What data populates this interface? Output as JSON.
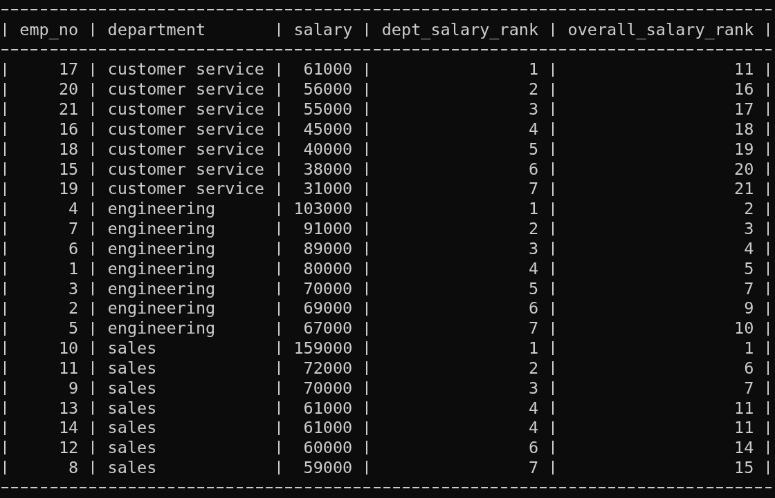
{
  "table": {
    "columns": [
      "emp_no",
      "department",
      "salary",
      "dept_salary_rank",
      "overall_salary_rank"
    ],
    "rows": [
      [
        "17",
        "customer service",
        "61000",
        "1",
        "11"
      ],
      [
        "20",
        "customer service",
        "56000",
        "2",
        "16"
      ],
      [
        "21",
        "customer service",
        "55000",
        "3",
        "17"
      ],
      [
        "16",
        "customer service",
        "45000",
        "4",
        "18"
      ],
      [
        "18",
        "customer service",
        "40000",
        "5",
        "19"
      ],
      [
        "15",
        "customer service",
        "38000",
        "6",
        "20"
      ],
      [
        "19",
        "customer service",
        "31000",
        "7",
        "21"
      ],
      [
        "4",
        "engineering",
        "103000",
        "1",
        "2"
      ],
      [
        "7",
        "engineering",
        "91000",
        "2",
        "3"
      ],
      [
        "6",
        "engineering",
        "89000",
        "3",
        "4"
      ],
      [
        "1",
        "engineering",
        "80000",
        "4",
        "5"
      ],
      [
        "3",
        "engineering",
        "70000",
        "5",
        "7"
      ],
      [
        "2",
        "engineering",
        "69000",
        "6",
        "9"
      ],
      [
        "5",
        "engineering",
        "67000",
        "7",
        "10"
      ],
      [
        "10",
        "sales",
        "159000",
        "1",
        "1"
      ],
      [
        "11",
        "sales",
        "72000",
        "2",
        "6"
      ],
      [
        "9",
        "sales",
        "70000",
        "3",
        "7"
      ],
      [
        "13",
        "sales",
        "61000",
        "4",
        "11"
      ],
      [
        "14",
        "sales",
        "61000",
        "4",
        "11"
      ],
      [
        "12",
        "sales",
        "60000",
        "6",
        "14"
      ],
      [
        "8",
        "sales",
        "59000",
        "7",
        "15"
      ]
    ]
  }
}
